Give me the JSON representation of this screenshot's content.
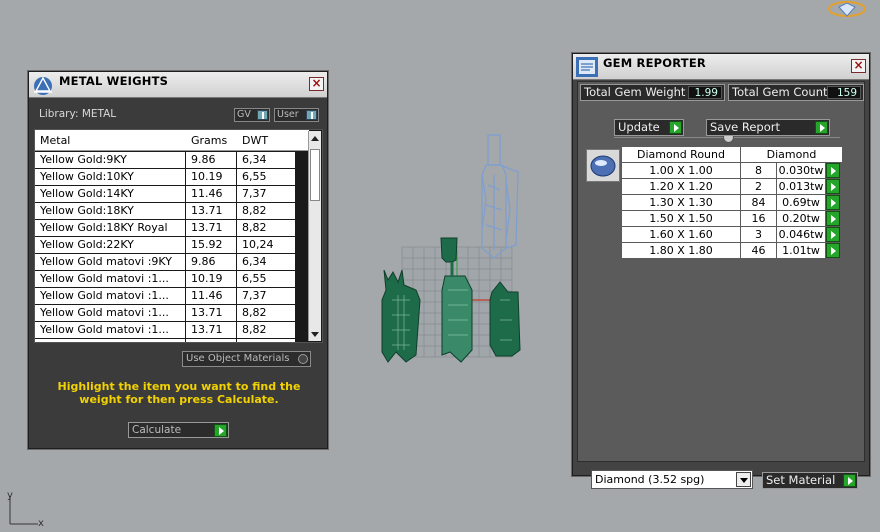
{
  "viewport": {
    "axis_y_label": "y",
    "axis_x_label": "x"
  },
  "metal_panel": {
    "title": "METAL WEIGHTS",
    "library_label": "Library: METAL",
    "gv_label": "GV",
    "user_label": "User",
    "columns": [
      "Metal",
      "Grams",
      "DWT"
    ],
    "rows": [
      {
        "metal": "Yellow Gold:9KY",
        "grams": "9.86",
        "dwt": "6,34"
      },
      {
        "metal": "Yellow Gold:10KY",
        "grams": "10.19",
        "dwt": "6,55"
      },
      {
        "metal": "Yellow Gold:14KY",
        "grams": "11.46",
        "dwt": "7,37"
      },
      {
        "metal": "Yellow Gold:18KY",
        "grams": "13.71",
        "dwt": "8,82"
      },
      {
        "metal": "Yellow Gold:18KY Royal",
        "grams": "13.71",
        "dwt": "8,82"
      },
      {
        "metal": "Yellow Gold:22KY",
        "grams": "15.92",
        "dwt": "10,24"
      },
      {
        "metal": "Yellow Gold matovi :9KY",
        "grams": "9.86",
        "dwt": "6,34"
      },
      {
        "metal": "Yellow Gold matovi :1...",
        "grams": "10.19",
        "dwt": "6,55"
      },
      {
        "metal": "Yellow Gold matovi :1...",
        "grams": "11.46",
        "dwt": "7,37"
      },
      {
        "metal": "Yellow Gold matovi :1...",
        "grams": "13.71",
        "dwt": "8,82"
      },
      {
        "metal": "Yellow Gold matovi :1...",
        "grams": "13.71",
        "dwt": "8,82"
      }
    ],
    "use_object_materials": "Use Object Materials",
    "hint": "Highlight the item you want to find the weight for then press Calculate.",
    "calculate_label": "Calculate"
  },
  "gem_panel": {
    "title": "GEM REPORTER",
    "total_weight_label": "Total Gem Weight",
    "total_weight_value": "1.99",
    "total_count_label": "Total Gem Count",
    "total_count_value": "159",
    "update_label": "Update",
    "save_report_label": "Save Report",
    "table_head": [
      "Diamond Round",
      "Diamond"
    ],
    "rows": [
      {
        "size": "1.00 X 1.00",
        "count": "8",
        "weight": "0.030tw"
      },
      {
        "size": "1.20 X 1.20",
        "count": "2",
        "weight": "0.013tw"
      },
      {
        "size": "1.30 X 1.30",
        "count": "84",
        "weight": "0.69tw"
      },
      {
        "size": "1.50 X 1.50",
        "count": "16",
        "weight": "0.20tw"
      },
      {
        "size": "1.60 X 1.60",
        "count": "3",
        "weight": "0.046tw"
      },
      {
        "size": "1.80 X 1.80",
        "count": "46",
        "weight": "1.01tw"
      }
    ],
    "material_value": "Diamond    (3.52 spg)",
    "set_material_label": "Set Material"
  },
  "colors": {
    "metal_green": "#1e6b4a",
    "gem_blue": "#7f9fd0",
    "hint_yellow": "#f2d200",
    "go_green": "#26a52b"
  }
}
